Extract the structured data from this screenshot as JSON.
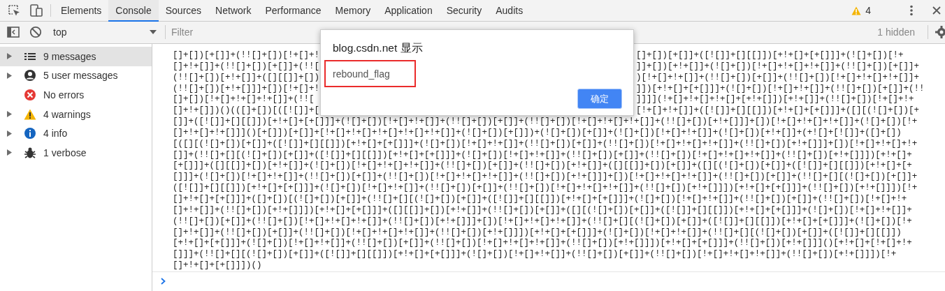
{
  "toolbar": {
    "tabs": [
      {
        "label": "Elements",
        "selected": false
      },
      {
        "label": "Console",
        "selected": true
      },
      {
        "label": "Sources",
        "selected": false
      },
      {
        "label": "Network",
        "selected": false
      },
      {
        "label": "Performance",
        "selected": false
      },
      {
        "label": "Memory",
        "selected": false
      },
      {
        "label": "Application",
        "selected": false
      },
      {
        "label": "Security",
        "selected": false
      },
      {
        "label": "Audits",
        "selected": false
      }
    ],
    "warning_count": "4"
  },
  "console_toolbar": {
    "context": "top",
    "filter": {
      "placeholder": "Filter"
    },
    "hidden_count": "1 hidden"
  },
  "sidebar": {
    "items": [
      {
        "label": "9 messages",
        "kind": "messages",
        "expandable": true,
        "selected": true
      },
      {
        "label": "5 user messages",
        "kind": "user",
        "expandable": true,
        "selected": false
      },
      {
        "label": "No errors",
        "kind": "error",
        "expandable": false,
        "selected": false
      },
      {
        "label": "4 warnings",
        "kind": "warning",
        "expandable": true,
        "selected": false
      },
      {
        "label": "4 info",
        "kind": "info",
        "expandable": true,
        "selected": false
      },
      {
        "label": "1 verbose",
        "kind": "verbose",
        "expandable": true,
        "selected": false
      }
    ]
  },
  "console": {
    "lines": [
      {
        "kind": "split",
        "left": "[]+[])[+[]]+(!![]+[])[!+[]+!",
        "right": "[]+[])[+[]]+([![]]+[][[]])[+!+[]+[+[]]]+(![]+[])[!+"
      },
      {
        "kind": "split",
        "left": "[]+!+[]]+(!![]+[])[+[]]+(!![",
        "right": "]]+[])[+!+[]]+(![]+[])[!+[]+!+[]+!+[]]+(!![]+[])[+[]]+"
      },
      {
        "kind": "split",
        "left": "(!![]+[])[+!+[]]+([][[]]+[])",
        "right": ")[!+[]+!+[]]+(!![]+[])[+[]]+(!![]+[])[!+[]+!+[]+!+[]]+"
      },
      {
        "kind": "split",
        "left": "(!![]+[])[+!+[]]]+[])[!+[]+!",
        "right": "]])[+!+[]+[+[]]]+(![]+[])[!+[]+!+[]]+(!![]+[])[+[]]+(!!"
      },
      {
        "kind": "split",
        "left": "[]+[])[!+[]+!+[]+!+[]]+(!![",
        "right": "]]]](!+[]+!+[]+!+[]+[+!+[]])[+!+[]]+(!![]+[])[!+[]+!+"
      },
      {
        "kind": "split",
        "left": "[]+!+[]])()(([]+[])[([![]]+[",
        "right": "[!+[]+!+[]]+([![]]+[][[]])[+!+[]+[+[]]]+([][(![]+[])[+"
      },
      {
        "kind": "full",
        "text": "[]]+([![]]+[][[]])[+!+[]+[+[]]]+(![]+[])[!+[]+!+[]]+(!![]+[])[+[]]+(!![]+[])[!+[]+!+[]+!+[]]+(!![]+[])[+!+[]]]+[])[!+[]+!+[]+!+[]]+(![]+[])[!+"
      },
      {
        "kind": "full",
        "text": "[]+!+[]+!+[]]]()[+[]])[+[]]+[!+[]+!+[]+!+[]+!+[]+!+[]]+(![]+[])[+[]])+(![]+[])[+[]]+(![]+[])[!+[]+!+[]]+(![]+[])[+!+[]]+(+![]+[![]]+([]+[])"
      },
      {
        "kind": "full",
        "text": "[([][(![]+[])[+[]]+([![]]+[][[]])[+!+[]+[+[]]]+(![]+[])[!+[]+!+[]]+(!![]+[])[+[]]+(!![]+[])[!+[]+!+[]+!+[]]+(!![]+[])[+!+[]]]+[])[!+[]+!+[]+!+"
      },
      {
        "kind": "full",
        "text": "[]]+(!![]+[][(![]+[])[+[]]+([![]]+[][[]])[+!+[]+[+[]]]+(![]+[])[!+[]+!+[]]+(!![]+[])[+[]]+(!![]+[])[!+[]+!+[]+!+[]]+(!![]+[])[+!+[]]])[+!+[]+"
      },
      {
        "kind": "full",
        "text": "[+[]]]+([][[]]+[])[+!+[]]+(![]+[])[!+[]+!+[]+!+[]]+(!![]+[])[+[]]+(!![]+[])[+!+[]]+([][[]]+[])[+[]]+([][(![]+[])[+[]]+([![]]+[][[]])[+!+[]+[+"
      },
      {
        "kind": "full",
        "text": "[]]]+(![]+[])[!+[]+!+[]]+(!![]+[])[+[]]+(!![]+[])[!+[]+!+[]+!+[]]+(!![]+[])[+!+[]]]+[])[!+[]+!+[]+!+[]]+(!![]+[])[+[]]+(!![]+[][(![]+[])[+[]]+"
      },
      {
        "kind": "full",
        "text": "([![]]+[][[]])[+!+[]+[+[]]]+(![]+[])[!+[]+!+[]]+(!![]+[])[+[]]+(!![]+[])[!+[]+!+[]+!+[]]+(!![]+[])[+!+[]]])[+!+[]+[+[]]]+(!![]+[])[+!+[]]])[!+"
      },
      {
        "kind": "full",
        "text": "[]+!+[]+[+[]]]+([]+[])[(![]+[])[+[]]+(!![]+[][(![]+[])[+[]]+([![]]+[][[]])[+!+[]+[+[]]]+(![]+[])[!+[]+!+[]]+(!![]+[])[+[]]+(!![]+[])[!+[]+!+"
      },
      {
        "kind": "full",
        "text": "[]+!+[]]+(!![]+[])[+!+[]]])[+!+[]+[+[]]]+([][[]]+[])[+!+[]]+(!![]+[])[+[]]+([][(![]+[])[+[]]+([![]]+[][[]])[+!+[]+[+[]]]+(![]+[])[!+[]+!+[]]+"
      },
      {
        "kind": "full",
        "text": "(!![]+[])[+[]]+(!![]+[])[!+[]+!+[]+!+[]]+(!![]+[])[+!+[]]]+[])[!+[]+!+[]+!+[]]+(!![]+[][(![]+[])[+[]]+([![]]+[][[]])[+!+[]+[+[]]]+(![]+[])[!+"
      },
      {
        "kind": "full",
        "text": "[]+!+[]]+(!![]+[])[+[]]+(!![]+[])[!+[]+!+[]+!+[]]+(!![]+[])[+!+[]]])[+!+[]+[+[]]]+(![]+[])[!+[]+!+[]]+(!![]+[][(![]+[])[+[]]+([![]]+[][[]])"
      },
      {
        "kind": "full",
        "text": "[+!+[]+[+[]]]+(![]+[])[!+[]+!+[]]+(!![]+[])[+[]]+(!![]+[])[!+[]+!+[]+!+[]]+(!![]+[])[+!+[]]])[+!+[]+[+[]]]+(!![]+[])[+!+[]]]()[+!+[]+[!+[]+!+"
      },
      {
        "kind": "full",
        "text": "[]]]+(!![]+[][(![]+[])[+[]]+([![]]+[][[]])[+!+[]+[+[]]]+(![]+[])[!+[]+!+[]]+(!![]+[])[+[]]+(!![]+[])[!+[]+!+[]+!+[]]+(!![]+[])[+!+[]]])[!+"
      },
      {
        "kind": "full",
        "text": "[]+!+[]+[+[]]])()"
      }
    ]
  },
  "dialog": {
    "title": "blog.csdn.net 显示",
    "message": "rebound_flag",
    "button": "确定"
  }
}
